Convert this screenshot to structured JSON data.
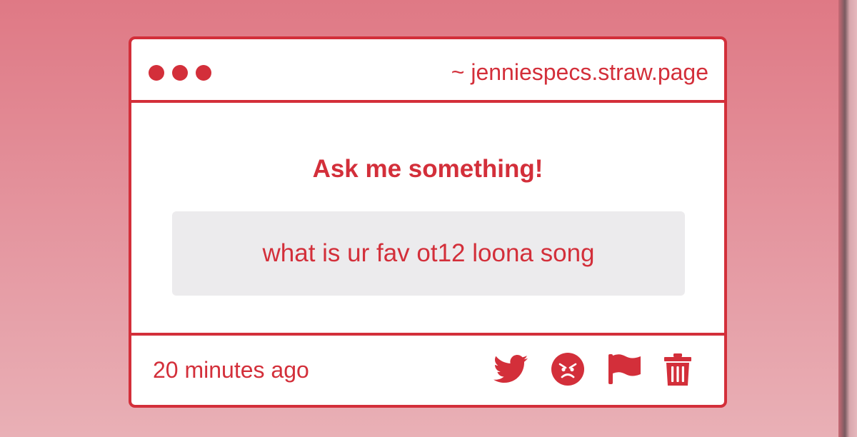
{
  "window": {
    "url": "~ jenniespecs.straw.page"
  },
  "main": {
    "title": "Ask me something!",
    "question": "what is ur fav ot12 loona song"
  },
  "footer": {
    "timestamp": "20 minutes ago",
    "actions": [
      "twitter-icon",
      "angry-face-icon",
      "flag-icon",
      "trash-icon"
    ]
  },
  "colors": {
    "accent": "#d32f3a",
    "background": "#e08a94",
    "question_box": "#ecebed",
    "card": "#ffffff"
  }
}
